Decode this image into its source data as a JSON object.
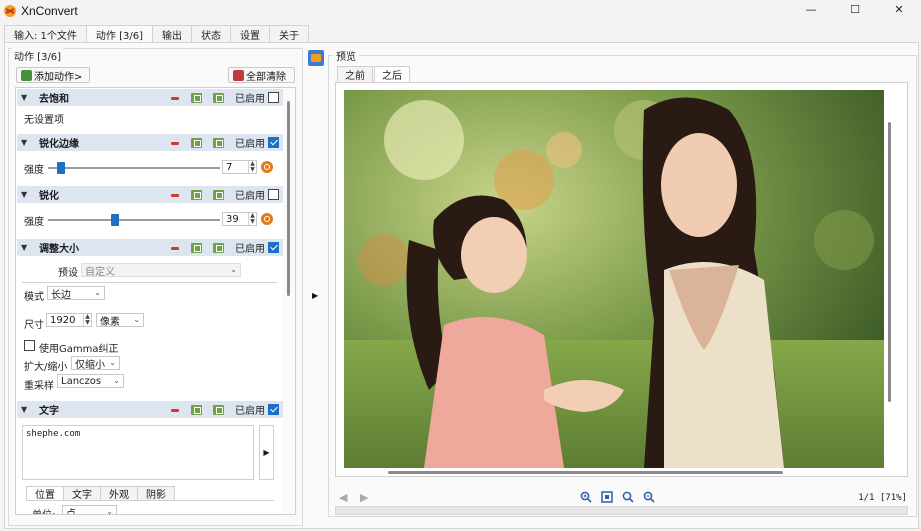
{
  "window": {
    "title": "XnConvert",
    "minimize": "—",
    "maximize": "☐",
    "close": "✕"
  },
  "main_tabs": [
    "输入: 1个文件",
    "动作 [3/6]",
    "输出",
    "状态",
    "设置",
    "关于"
  ],
  "actions_panel": {
    "group_title": "动作 [3/6]",
    "add_action": "添加动作>",
    "clear_all": "全部清除",
    "enabled_label": "已启用",
    "items": [
      {
        "name": "去饱和",
        "enabled": false,
        "body": "无设置项"
      },
      {
        "name": "锐化边缘",
        "enabled": true,
        "param_label": "强度",
        "value": "7",
        "level": 0.12
      },
      {
        "name": "锐化",
        "enabled": false,
        "param_label": "强度",
        "value": "39",
        "level": 0.39
      },
      {
        "name": "调整大小",
        "enabled": true,
        "preset_label": "预设",
        "preset_value": "自定义",
        "mode_label": "模式",
        "mode_value": "长边",
        "size_label": "尺寸",
        "size_value": "1920",
        "unit_value": "像素",
        "gamma_label": "使用Gamma纠正",
        "scale_label": "扩大/缩小",
        "scale_value": "仅缩小",
        "resample_label": "重采样",
        "resample_value": "Lanczos"
      },
      {
        "name": "文字",
        "enabled": true,
        "text": "shephe.com",
        "subtabs": [
          "位置",
          "文字",
          "外观",
          "阴影"
        ],
        "cutoff_label": "单位:",
        "cutoff_value": "点"
      }
    ]
  },
  "preview": {
    "group_title": "预览",
    "tabs": [
      "之前",
      "之后"
    ],
    "active_tab": "之后",
    "page_info": "1/1 [71%]"
  },
  "colors": {
    "accent": "#1f6fc5",
    "header_bg": "#dde5f0",
    "remove": "#d83434",
    "move": "#6ea14a",
    "reset": "#e07a1a"
  }
}
